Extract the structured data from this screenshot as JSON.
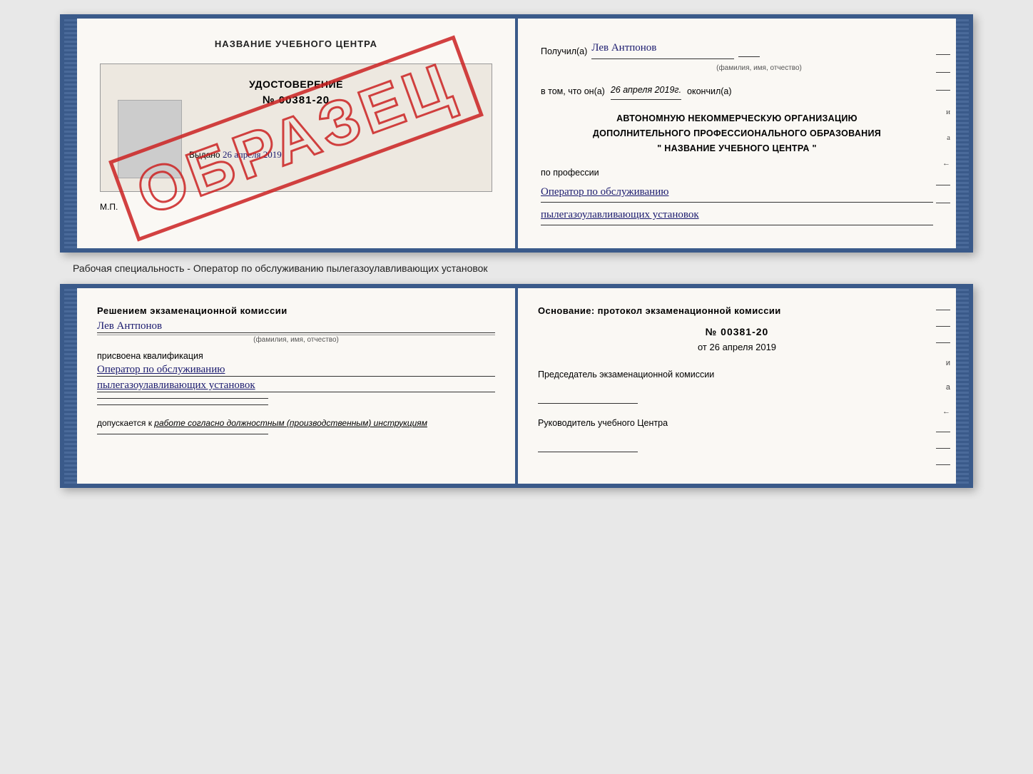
{
  "top_spread": {
    "left_page": {
      "title": "НАЗВАНИЕ УЧЕБНОГО ЦЕНТРА",
      "certificate": {
        "title": "УДОСТОВЕРЕНИЕ",
        "number": "№ 00381-20",
        "issued_label": "Выдано",
        "issued_date": "26 апреля 2019"
      },
      "watermark": "ОБРАЗЕЦ",
      "mp_label": "М.П."
    },
    "right_page": {
      "received_label": "Получил(а)",
      "recipient_name": "Лев Антпонов",
      "recipient_sublabel": "(фамилия, имя, отчество)",
      "completed_prefix": "в том, что он(а)",
      "completed_date": "26 апреля 2019г.",
      "completed_suffix": "окончил(а)",
      "org_line1": "АВТОНОМНУЮ НЕКОММЕРЧЕСКУЮ ОРГАНИЗАЦИЮ",
      "org_line2": "ДОПОЛНИТЕЛЬНОГО ПРОФЕССИОНАЛЬНОГО ОБРАЗОВАНИЯ",
      "org_line3": "\" НАЗВАНИЕ УЧЕБНОГО ЦЕНТРА \"",
      "profession_label": "по профессии",
      "profession_line1": "Оператор по обслуживанию",
      "profession_line2": "пылегазоулавливающих установок",
      "margin_labels": [
        "и",
        "а",
        "←",
        "–",
        "–",
        "–",
        "–"
      ]
    }
  },
  "separator": {
    "text": "Рабочая специальность - Оператор по обслуживанию пылегазоулавливающих установок"
  },
  "bottom_spread": {
    "left_page": {
      "decision_heading": "Решением экзаменационной комиссии",
      "person_name": "Лев Антпонов",
      "person_sublabel": "(фамилия, имя, отчество)",
      "qualification_label": "присвоена квалификация",
      "qualification_line1": "Оператор по обслуживанию",
      "qualification_line2": "пылегазоулавливающих установок",
      "allowed_prefix": "допускается к",
      "allowed_value": "работе согласно должностным (производственным) инструкциям"
    },
    "right_page": {
      "basis_heading": "Основание: протокол экзаменационной комиссии",
      "protocol_number": "№ 00381-20",
      "protocol_date_prefix": "от",
      "protocol_date": "26 апреля 2019",
      "chairman_label": "Председатель экзаменационной комиссии",
      "center_head_label": "Руководитель учебного Центра",
      "margin_labels": [
        "–",
        "–",
        "–",
        "и",
        "а",
        "←",
        "–",
        "–",
        "–"
      ]
    }
  }
}
